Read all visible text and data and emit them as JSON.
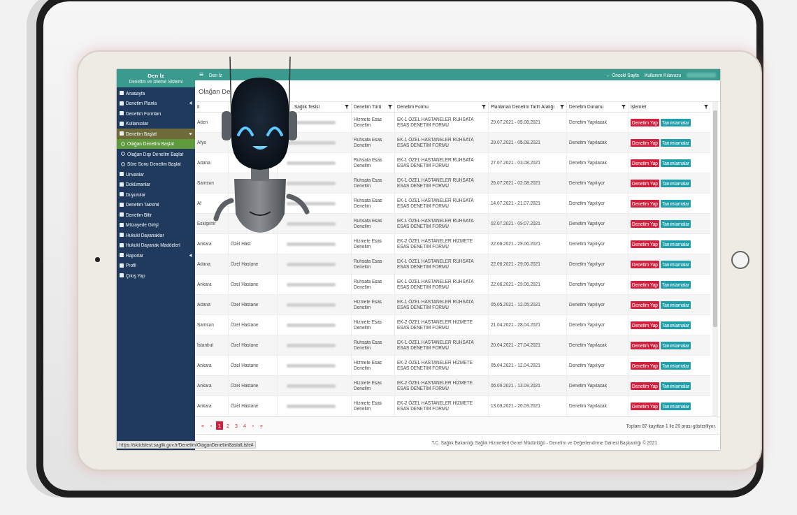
{
  "sidebar": {
    "logo": {
      "title": "Den İz",
      "subtitle": "Denetim ve İzleme Sistemi"
    },
    "items": [
      {
        "label": "Anasayfa",
        "selected": false
      },
      {
        "label": "Denetim Planla",
        "selected": false,
        "expanded": false
      },
      {
        "label": "Denetim Formları",
        "selected": false
      },
      {
        "label": "Kullanıcılar",
        "selected": false
      },
      {
        "label": "Denetim Başlat",
        "selected": false,
        "expanded": true,
        "children": [
          {
            "label": "Olağan Denetim Başlat",
            "selected": true
          },
          {
            "label": "Olağan Dışı Denetim Başlat",
            "selected": false
          },
          {
            "label": "Süre Sonu Denetim Başlat",
            "selected": false
          }
        ]
      },
      {
        "label": "Unvanlar",
        "selected": false
      },
      {
        "label": "Dokümanlar",
        "selected": false
      },
      {
        "label": "Duyurular",
        "selected": false
      },
      {
        "label": "Denetim Takvimi",
        "selected": false
      },
      {
        "label": "Denetim Bitir",
        "selected": false
      },
      {
        "label": "Müzayede Girişi",
        "selected": false
      },
      {
        "label": "Hukuki Dayanaklar",
        "selected": false
      },
      {
        "label": "Hukuki Dayanak Maddeleri",
        "selected": false
      },
      {
        "label": "Raporlar",
        "selected": false,
        "expanded": false
      },
      {
        "label": "Profil",
        "selected": false
      },
      {
        "label": "Çıkış Yap",
        "selected": false
      }
    ]
  },
  "topbar": {
    "menu_glyph": "☰",
    "title": "Den İz",
    "links": [
      "← Önceki Sayfa",
      "Kullanım Kılavuzu"
    ]
  },
  "page_title": "Olağan De",
  "table": {
    "columns": [
      "İl",
      "",
      "Sağlık Tesisi",
      "Denetim Türü",
      "Denetim Formu",
      "Planlanan Denetim Tarih Aralığı",
      "Denetim Durumu",
      "İşlemler"
    ],
    "rows": [
      [
        "Aden",
        "",
        "",
        "Hizmete Esas Denetim",
        "EK-1 ÖZEL HASTANELER RUHSATA ESAS DENETİM FORMU",
        "29.07.2021 - 05.08.2021",
        "Denetim Yapılacak",
        [
          "Denetim Yap",
          "Tanımlamalar"
        ]
      ],
      [
        "Afyo",
        "",
        "",
        "Ruhsata Esas Denetim",
        "EK-1 ÖZEL HASTANELER RUHSATA ESAS DENETİM FORMU",
        "29.07.2021 - 05.08.2021",
        "Denetim Yapılacak",
        [
          "Denetim Yap",
          "Tanımlamalar"
        ]
      ],
      [
        "Adana",
        "",
        "",
        "Ruhsata Esas Denetim",
        "EK-1 ÖZEL HASTANELER RUHSATA ESAS DENETİM FORMU",
        "27.07.2021 - 03.08.2021",
        "Denetim Yapılacak",
        [
          "Denetim Yap",
          "Tanımlamalar"
        ]
      ],
      [
        "Samsun",
        "",
        "",
        "Ruhsata Esas Denetim",
        "EK-1 ÖZEL HASTANELER RUHSATA ESAS DENETİM FORMU",
        "26.07.2021 - 02.08.2021",
        "Denetim Yapılıyor",
        [
          "Denetim Yap",
          "Tanımlamalar"
        ]
      ],
      [
        "Af",
        "",
        "",
        "Ruhsata Esas Denetim",
        "EK-1 ÖZEL HASTANELER RUHSATA ESAS DENETİM FORMU",
        "14.07.2021 - 21.07.2021",
        "Denetim Yapılıyor",
        [
          "Denetim Yap",
          "Tanımlamalar"
        ]
      ],
      [
        "Eskişehir",
        "",
        "",
        "Ruhsata Esas Denetim",
        "EK-1 ÖZEL HASTANELER RUHSATA ESAS DENETİM FORMU",
        "02.07.2021 - 09.07.2021",
        "Denetim Yapılıyor",
        [
          "Denetim Yap",
          "Tanımlamalar"
        ]
      ],
      [
        "Ankara",
        "Özel Hast",
        "",
        "Hizmete Esas Denetim",
        "EK-2 ÖZEL HASTANELER HİZMETE ESAS DENETİM FORMU",
        "22.06.2021 - 29.06.2021",
        "Denetim Yapılıyor",
        [
          "Denetim Yap",
          "Tanımlamalar"
        ]
      ],
      [
        "Adana",
        "Özel Hastane",
        "",
        "Ruhsata Esas Denetim",
        "EK-1 ÖZEL HASTANELER RUHSATA ESAS DENETİM FORMU",
        "22.06.2021 - 29.06.2021",
        "Denetim Yapılıyor",
        [
          "Denetim Yap",
          "Tanımlamalar"
        ]
      ],
      [
        "Ankara",
        "Özel Hastane",
        "",
        "Ruhsata Esas Denetim",
        "EK-1 ÖZEL HASTANELER RUHSATA ESAS DENETİM FORMU",
        "22.06.2021 - 29.06.2021",
        "Denetim Yapılıyor",
        [
          "Denetim Yap",
          "Tanımlamalar"
        ]
      ],
      [
        "Adana",
        "Özel Hastane",
        "",
        "Hizmete Esas Denetim",
        "EK-1 ÖZEL HASTANELER RUHSATA ESAS DENETİM FORMU",
        "05.05.2021 - 12.05.2021",
        "Denetim Yapılıyor",
        [
          "Denetim Yap",
          "Tanımlamalar"
        ]
      ],
      [
        "Samsun",
        "Özel Hastane",
        "",
        "Hizmete Esas Denetim",
        "EK-2 ÖZEL HASTANELER HİZMETE ESAS DENETİM FORMU",
        "21.04.2021 - 28.04.2021",
        "Denetim Yapılıyor",
        [
          "Denetim Yap",
          "Tanımlamalar"
        ]
      ],
      [
        "İstanbul",
        "Özel Hastane",
        "",
        "Ruhsata Esas Denetim",
        "EK-1 ÖZEL HASTANELER RUHSATA ESAS DENETİM FORMU",
        "20.04.2021 - 27.04.2021",
        "Denetim Yapılacak",
        [
          "Denetim Yap",
          "Tanımlamalar"
        ]
      ],
      [
        "Ankara",
        "Özel Hastane",
        "",
        "Hizmete Esas Denetim",
        "EK-2 ÖZEL HASTANELER HİZMETE ESAS DENETİM FORMU",
        "05.04.2021 - 12.04.2021",
        "Denetim Yapılıyor",
        [
          "Denetim Yap",
          "Tanımlamalar"
        ]
      ],
      [
        "Ankara",
        "Özel Hastane",
        "",
        "Hizmete Esas Denetim",
        "EK-2 ÖZEL HASTANELER HİZMETE ESAS DENETİM FORMU",
        "06.09.2021 - 13.09.2021",
        "Denetim Yapılacak",
        [
          "Denetim Yap",
          "Tanımlamalar"
        ]
      ],
      [
        "Ankara",
        "Özel Hastane",
        "",
        "Hizmete Esas Denetim",
        "EK-2 ÖZEL HASTANELER HİZMETE ESAS DENETİM FORMU",
        "13.09.2021 - 20.09.2021",
        "Denetim Yapılacak",
        [
          "Denetim Yap",
          "Tanımlamalar"
        ]
      ]
    ]
  },
  "pagination": {
    "first": "«",
    "prev": "‹",
    "pages": [
      {
        "label": "1",
        "selected": true
      },
      {
        "label": "2",
        "selected": false
      },
      {
        "label": "3",
        "selected": false
      },
      {
        "label": "4",
        "selected": false
      }
    ],
    "next": "›",
    "last": "»",
    "summary": "Toplam 87 kayıttan 1 ile 20 arası gösteriliyor."
  },
  "footer": "T.C. Sağlık Bakanlığı Sağlık Hizmetleri Genel Müdürlüğü - Denetim ve Değerlendirme Dairesi Başkanlığı © 2021",
  "status_url": "https://skddstest.saglik.gov.tr/Denetim/OlaganDenetimBaslatListe#"
}
